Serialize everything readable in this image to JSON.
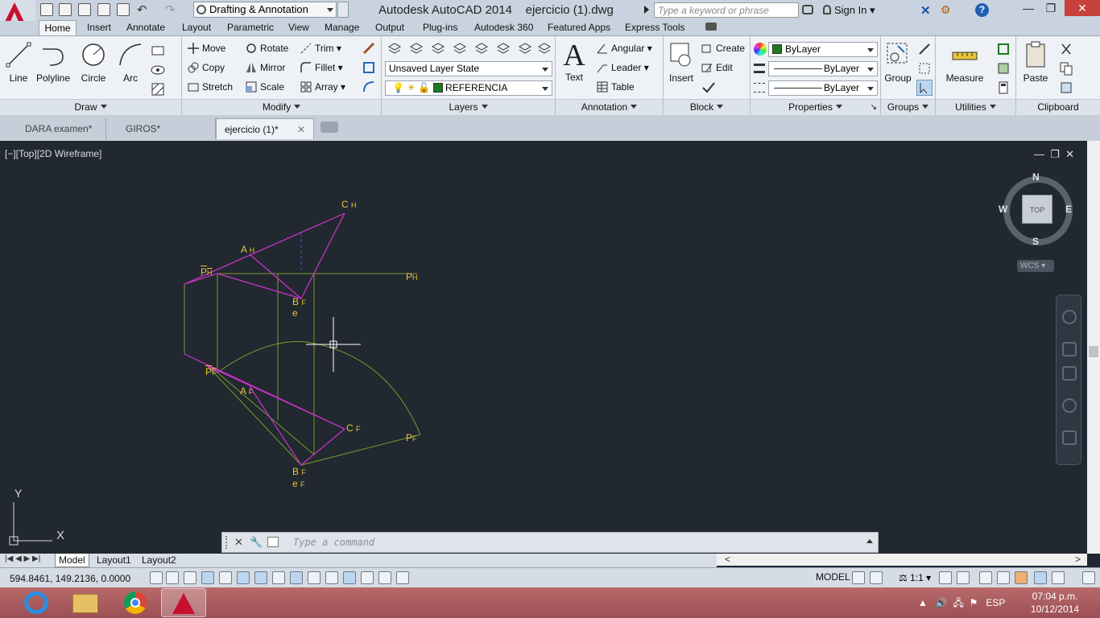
{
  "title_bar": {
    "workspace": "Drafting & Annotation",
    "app_title": "Autodesk AutoCAD 2014",
    "file_name": "ejercicio (1).dwg",
    "search_placeholder": "Type a keyword or phrase",
    "sign_in": "Sign In"
  },
  "ribbon_tabs": [
    "Home",
    "Insert",
    "Annotate",
    "Layout",
    "Parametric",
    "View",
    "Manage",
    "Output",
    "Plug-ins",
    "Autodesk 360",
    "Featured Apps",
    "Express Tools"
  ],
  "draw": {
    "title": "Draw",
    "line": "Line",
    "polyline": "Polyline",
    "circle": "Circle",
    "arc": "Arc"
  },
  "modify": {
    "title": "Modify",
    "move": "Move",
    "rotate": "Rotate",
    "trim": "Trim",
    "copy": "Copy",
    "mirror": "Mirror",
    "fillet": "Fillet",
    "stretch": "Stretch",
    "scale": "Scale",
    "array": "Array"
  },
  "layers": {
    "title": "Layers",
    "layer_state": "Unsaved Layer State",
    "current_layer": "REFERENCIA",
    "layer_color": "#1b7a1b"
  },
  "annotation": {
    "title": "Annotation",
    "text": "Text",
    "angular": "Angular",
    "leader": "Leader",
    "table": "Table"
  },
  "block": {
    "title": "Block",
    "insert": "Insert",
    "create": "Create",
    "edit": "Edit"
  },
  "properties": {
    "title": "Properties",
    "color": "ByLayer",
    "linetype": "ByLayer",
    "lineweight": "ByLayer"
  },
  "groups": {
    "title": "Groups",
    "group": "Group"
  },
  "utilities": {
    "title": "Utilities",
    "measure": "Measure"
  },
  "clipboard": {
    "title": "Clipboard",
    "paste": "Paste"
  },
  "doc_tabs": [
    "DARA examen*",
    "GIROS*",
    "ejercicio (1)*"
  ],
  "viewport": {
    "label": "[−][Top][2D Wireframe]",
    "viewcube": {
      "top": "TOP",
      "n": "N",
      "s": "S",
      "e": "E",
      "w": "W",
      "wcs": "WCS"
    },
    "drawing_labels": {
      "c_h": "C",
      "c_h_sub": "H",
      "a_h": "A",
      "a_h_sub": "H",
      "p_h": "P",
      "p_h_sub": "H",
      "ph_right": "P",
      "ph_right_sub": "H",
      "b_f1": "B",
      "b_f1_sub": "F",
      "e1": "e",
      "p_f": "P",
      "p_f_sub": "F",
      "a_f": "A",
      "a_f_sub": "F",
      "c_f": "C",
      "c_f_sub": "F",
      "pf_right": "P",
      "pf_right_sub": "F",
      "b_f2": "B",
      "b_f2_sub": "F",
      "e2": "e",
      "e2_sub": "F"
    },
    "ucs": {
      "y": "Y",
      "x": "X"
    }
  },
  "command_line": {
    "placeholder": "Type a command"
  },
  "layout_tabs": [
    "Model",
    "Layout1",
    "Layout2"
  ],
  "status": {
    "coords": "594.8461, 149.2136, 0.0000",
    "model": "MODEL",
    "scale": "1:1"
  },
  "taskbar": {
    "lang": "ESP",
    "time": "07:04 p.m.",
    "date": "10/12/2014"
  },
  "colors": {
    "accent": "#c8102e",
    "drawing_magenta": "#cc33cc",
    "drawing_green": "#7a9a2a",
    "label_yellow": "#e8c63a"
  }
}
